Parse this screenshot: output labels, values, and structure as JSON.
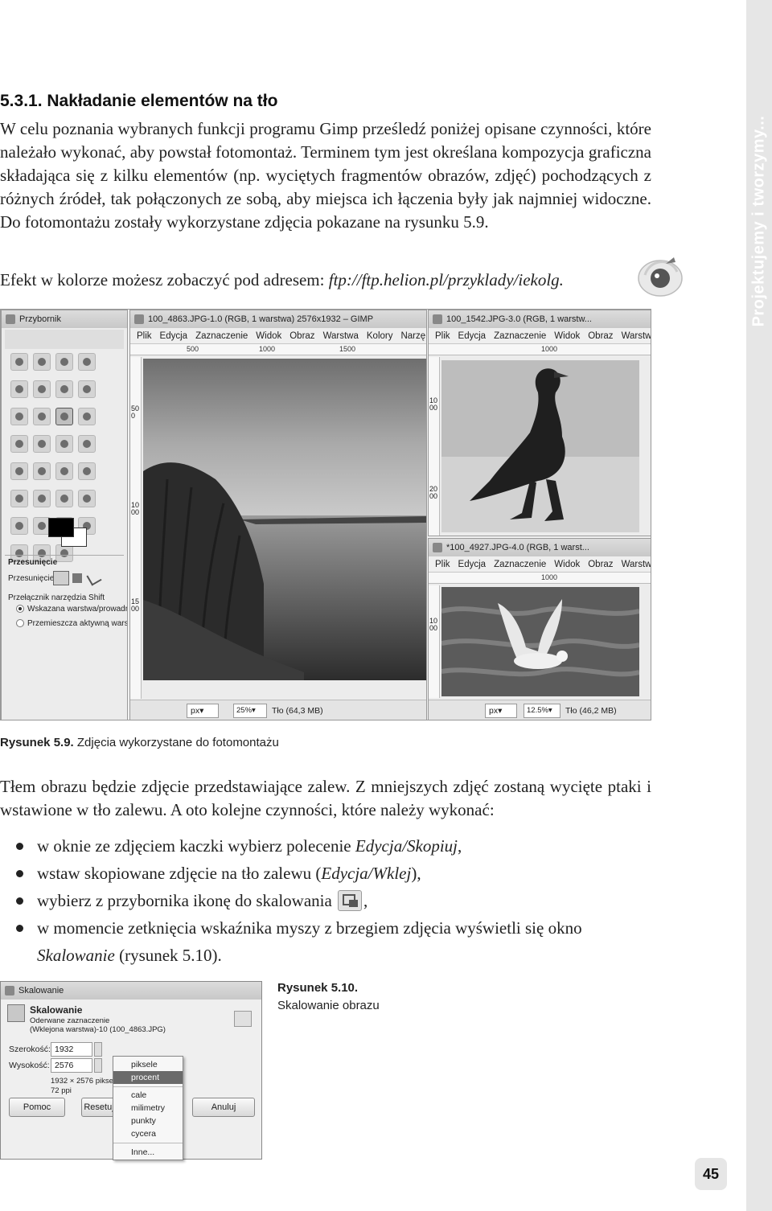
{
  "side_band": {
    "label": "Projektujemy i tworzymy..."
  },
  "section": {
    "heading": "5.3.1. Nakładanie elementów na tło",
    "intro": "W celu poznania wybranych funkcji programu Gimp prześledź poniżej opisane czynności, które należało wykonać, aby powstał fotomontaż. Terminem tym jest określana kompozycja graficzna składająca się z kilku elementów (np. wyciętych fragmentów obrazów, zdjęć) pochodzących z różnych źródeł, tak połączonych ze sobą, aby miejsca ich łączenia były jak najmniej widoczne. Do fotomontażu zostały wykorzystane zdjęcia pokazane na rysunku 5.9.",
    "link_prefix": "Efekt w kolorze możesz zobaczyć pod adresem: ",
    "link_url": "ftp://ftp.helion.pl/przyklady/iekolg."
  },
  "screenshot": {
    "toolbox": {
      "title": "Przybornik",
      "tool_options_title": "Przesunięcie",
      "move_label": "Przesunięcie:",
      "switch_label": "Przełącznik narzędzia  Shift",
      "option1": "Wskazana warstwa/prowadn",
      "option2": "Przemieszcza aktywną warst"
    },
    "main_window": {
      "title": "100_4863.JPG-1.0 (RGB, 1 warstwa) 2576x1932 – GIMP",
      "menu": [
        "Plik",
        "Edycja",
        "Zaznaczenie",
        "Widok",
        "Obraz",
        "Warstwa",
        "Kolory",
        "Narzę"
      ],
      "ruler_ticks": [
        "500",
        "1000",
        "1500"
      ],
      "vruler_ticks": [
        "500",
        "1000",
        "1500"
      ],
      "unit": "px▾",
      "zoom": "25%▾",
      "layer": "Tło (64,3 MB)"
    },
    "bird_window": {
      "title": "100_1542.JPG-3.0 (RGB, 1 warstw...",
      "menu": [
        "Plik",
        "Edycja",
        "Zaznaczenie",
        "Widok",
        "Obraz",
        "Warstw"
      ],
      "ruler_ticks": [
        "1000"
      ],
      "vruler_ticks": [
        "1000",
        "2000"
      ]
    },
    "gull_window": {
      "title": "*100_4927.JPG-4.0 (RGB, 1 warst...",
      "menu": [
        "Plik",
        "Edycja",
        "Zaznaczenie",
        "Widok",
        "Obraz",
        "Warstw"
      ],
      "ruler_ticks": [
        "1000"
      ],
      "vruler_ticks": [
        "1000"
      ],
      "unit": "px▾",
      "zoom": "12.5%▾",
      "layer": "Tło (46,2 MB)"
    }
  },
  "figure_5_9": {
    "label": "Rysunek 5.9.",
    "caption": "Zdjęcia wykorzystane do fotomontażu"
  },
  "body": {
    "paragraph": "Tłem obrazu będzie zdjęcie przedstawiające zalew. Z mniejszych zdjęć zostaną wycięte ptaki i wstawione w tło zalewu. A oto kolejne czynności, które należy wykonać:",
    "bullets": [
      {
        "text": "w oknie ze zdjęciem kaczki wybierz polecenie ",
        "italic": "Edycja/Skopiuj",
        "after": ","
      },
      {
        "text": "wstaw skopiowane zdjęcie na tło zalewu (",
        "italic": "Edycja/Wklej",
        "after": "),"
      },
      {
        "text": "wybierz z przybornika ikonę do skalowania ",
        "after": ","
      },
      {
        "text": "w momencie zetknięcia wskaźnika myszy z brzegiem zdjęcia wyświetli się okno ",
        "italic": "Skalowanie",
        "after": " (rysunek 5.10)."
      }
    ]
  },
  "dialog": {
    "window_title": "Skalowanie",
    "heading": "Skalowanie",
    "sub1": "Oderwane zaznaczenie",
    "sub2": "(Wklejona warstwa)-10 (100_4863.JPG)",
    "width_label": "Szerokość:",
    "width_value": "1932",
    "height_label": "Wysokość:",
    "height_value": "2576",
    "size_info": "1932 × 2576 piksel",
    "ppi_info": "72 ppi",
    "help_btn": "Pomoc",
    "reset_btn": "Resetuj",
    "cancel_btn": "Anuluj",
    "menu": [
      "piksele",
      "procent",
      "cale",
      "milimetry",
      "punkty",
      "cycera",
      "Inne..."
    ],
    "menu_selected": "procent"
  },
  "figure_5_10": {
    "label": "Rysunek 5.10.",
    "caption": "Skalowanie obrazu"
  },
  "page_number": "45"
}
